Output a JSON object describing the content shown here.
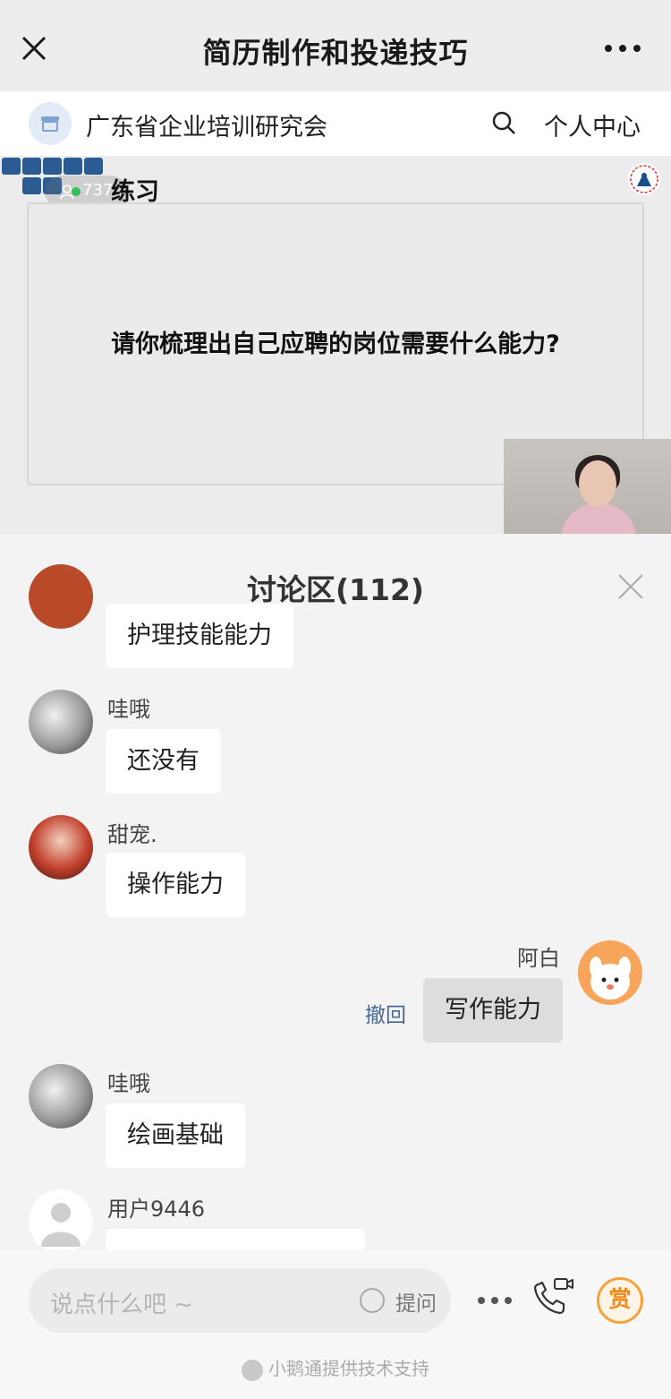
{
  "topbar": {
    "title": "简历制作和投递技巧"
  },
  "shop": {
    "name": "广东省企业培训研究会",
    "user_center": "个人中心"
  },
  "stage": {
    "viewers": "737",
    "section_label": "练习",
    "slide_text": "请你梳理出自己应聘的岗位需要什么能力?"
  },
  "discussion": {
    "title": "讨论区(112)",
    "messages": [
      {
        "user": "",
        "text": "护理技能能力"
      },
      {
        "user": "哇哦",
        "text": "还没有"
      },
      {
        "user": "甜宠.",
        "text": "操作能力"
      },
      {
        "user": "阿白",
        "text": "写作能力",
        "recall": "撤回"
      },
      {
        "user": "哇哦",
        "text": "绘画基础"
      },
      {
        "user": "用户9446",
        "text": ""
      }
    ]
  },
  "bottom": {
    "placeholder": "说点什么吧 ~",
    "ask": "提问",
    "reward": "赏",
    "footer": "小鹅通提供技术支持"
  },
  "colors": {
    "accent_blue": "#2b5b93",
    "reward_orange": "#f08a1c",
    "recall_blue": "#4a6a96"
  }
}
